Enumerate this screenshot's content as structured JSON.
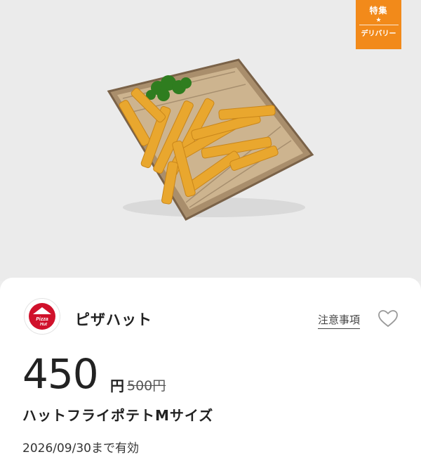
{
  "badge": {
    "top": "特集",
    "star": "★",
    "bottom": "デリバリー"
  },
  "shop": {
    "name": "ピザハット",
    "logo_text": "Pizza Hut"
  },
  "actions": {
    "notice_label": "注意事項",
    "favorite_icon": "heart-outline-icon"
  },
  "offer": {
    "price": "450",
    "yen": "円",
    "original_price": "500円",
    "product_name": "ハットフライポテトMサイズ",
    "validity": "2026/09/30まで有効"
  },
  "colors": {
    "badge": "#f28a1a",
    "brand_red": "#d0112b",
    "background": "#ebebeb"
  }
}
